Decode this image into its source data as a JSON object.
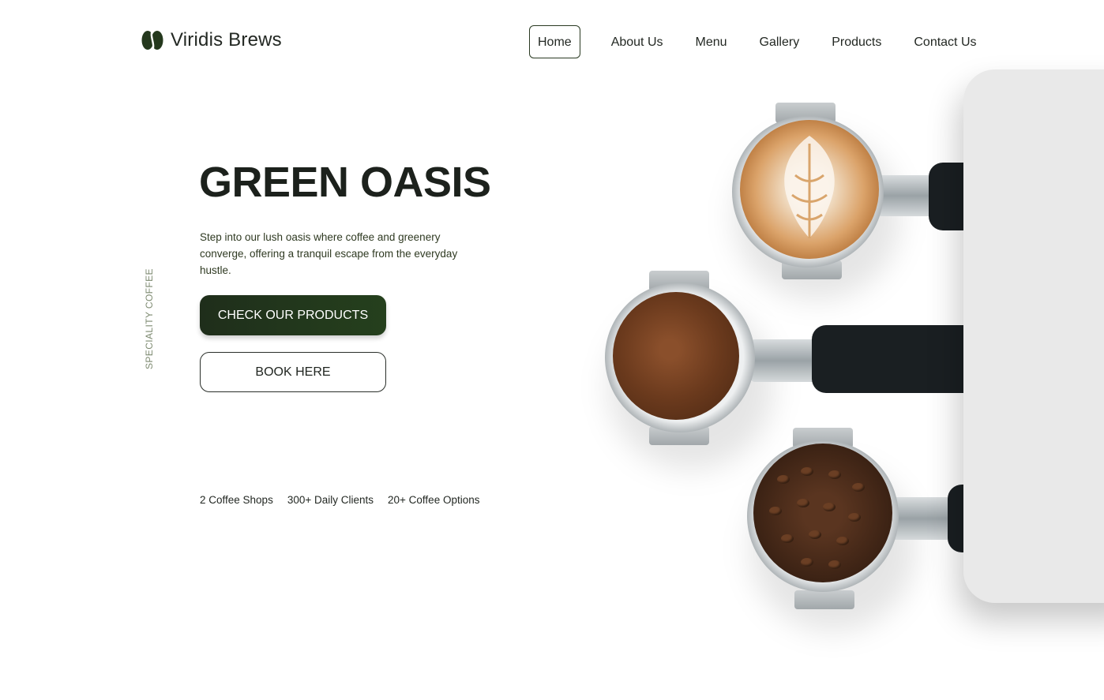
{
  "brand": {
    "name": "Viridis Brews",
    "icon": "coffee-bean-icon",
    "accent_color": "#24381d"
  },
  "nav": {
    "items": [
      {
        "label": "Home",
        "active": true
      },
      {
        "label": "About Us",
        "active": false
      },
      {
        "label": "Menu",
        "active": false
      },
      {
        "label": "Gallery",
        "active": false
      },
      {
        "label": "Products",
        "active": false
      },
      {
        "label": "Contact Us",
        "active": false
      }
    ]
  },
  "side_label": "SPECIALITY COFFEE",
  "hero": {
    "title": "GREEN OASIS",
    "description": "Step into our lush oasis where coffee and greenery converge, offering a tranquil escape from the everyday hustle.",
    "primary_button": "CHECK OUR PRODUCTS",
    "secondary_button": "BOOK HERE"
  },
  "stats": [
    "2 Coffee Shops",
    "300+ Daily Clients",
    "20+ Coffee Options"
  ],
  "image": {
    "subject": "three espresso portafilters: latte art, ground coffee, coffee beans"
  }
}
